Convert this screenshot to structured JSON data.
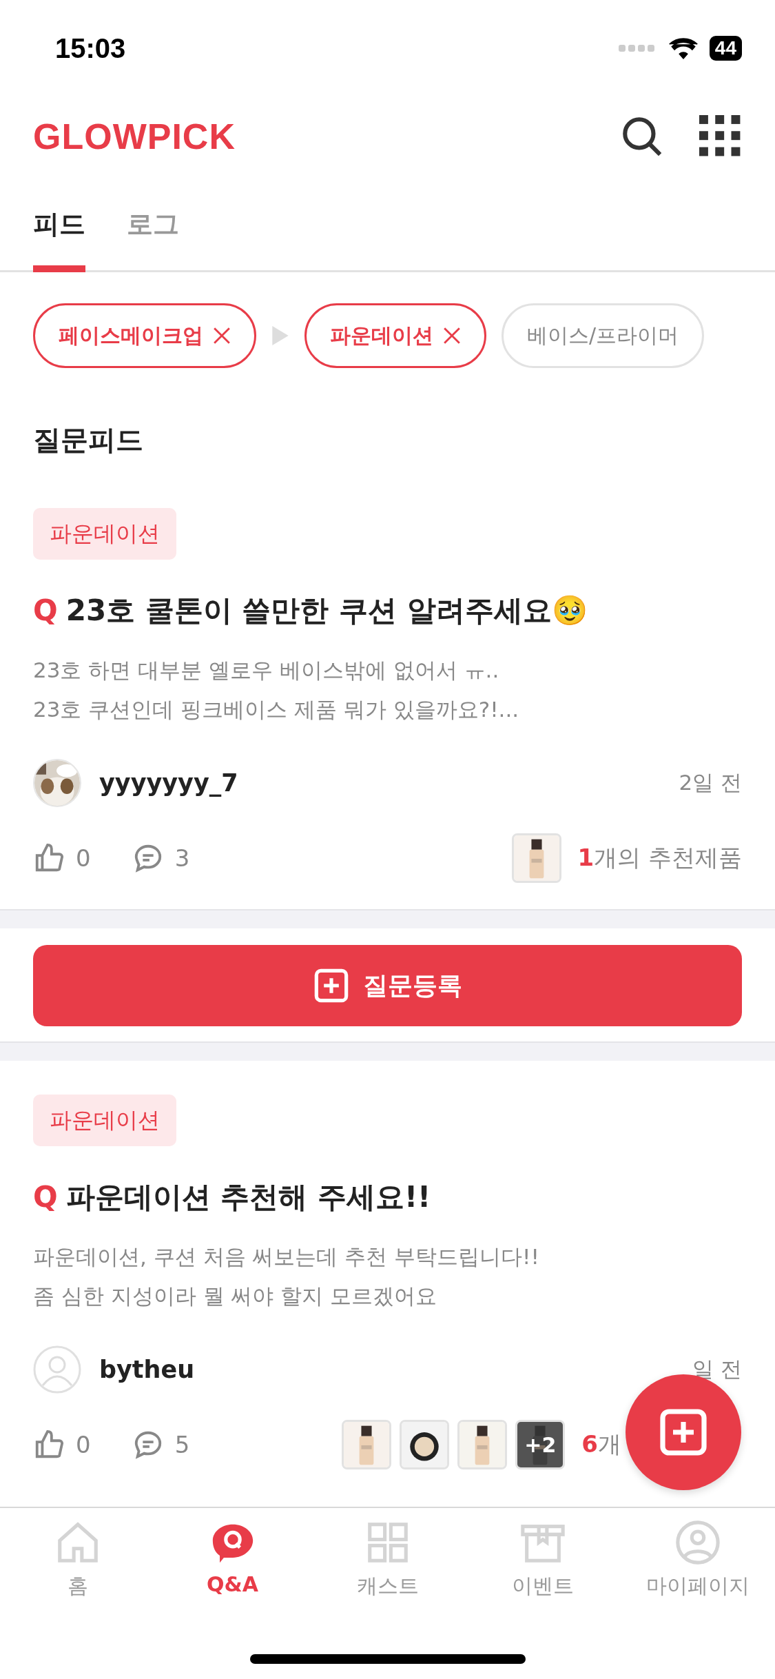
{
  "status_bar": {
    "time": "15:03",
    "battery": "44"
  },
  "header": {
    "logo": "GLOWPICK"
  },
  "tabs": [
    {
      "label": "피드",
      "selected": true
    },
    {
      "label": "로그",
      "selected": false
    }
  ],
  "filters": [
    {
      "label": "페이스메이크업",
      "selected": true
    },
    {
      "label": "파운데이션",
      "selected": true
    },
    {
      "label": "베이스/프라이머",
      "selected": false
    }
  ],
  "section_title": "질문피드",
  "posts": [
    {
      "tag": "파운데이션",
      "q_mark": "Q",
      "title": "23호 쿨톤이 쓸만한 쿠션 알려주세요🥹",
      "body": [
        "23호 하면 대부분 옐로우 베이스밖에 없어서 ㅠ..",
        "23호 쿠션인데 핑크베이스 제품 뭐가 있을까요?!..."
      ],
      "author": "yyyyyyy_7",
      "avatar": {
        "kind": "picture"
      },
      "time": "2일 전",
      "likes": "0",
      "comments": "3",
      "products": [
        {
          "kind": "picture"
        }
      ],
      "rec_count": "1",
      "rec_label": "개의 추천제품"
    },
    {
      "tag": "파운데이션",
      "q_mark": "Q",
      "title": "파운데이션 추천해 주세요!!",
      "body": [
        "파운데이션, 쿠션 처음 써보는데 추천 부탁드립니다!!",
        "좀 심한 지성이라 뭘 써야 할지 모르겠어요"
      ],
      "author": "bytheu",
      "avatar": {
        "kind": "default"
      },
      "time": "일 전",
      "likes": "0",
      "comments": "5",
      "products": [
        {
          "kind": "picture"
        },
        {
          "kind": "picture"
        },
        {
          "kind": "picture"
        },
        {
          "kind": "picture",
          "more": "+2"
        }
      ],
      "rec_count": "6",
      "rec_label": "개"
    }
  ],
  "ask_button": "질문등록",
  "nav": [
    {
      "label": "홈",
      "kind": "home",
      "selected": false
    },
    {
      "label": "Q&A",
      "kind": "qa",
      "selected": true
    },
    {
      "label": "캐스트",
      "kind": "grid",
      "selected": false
    },
    {
      "label": "이벤트",
      "kind": "box",
      "selected": false
    },
    {
      "label": "마이페이지",
      "kind": "user",
      "selected": false
    }
  ]
}
